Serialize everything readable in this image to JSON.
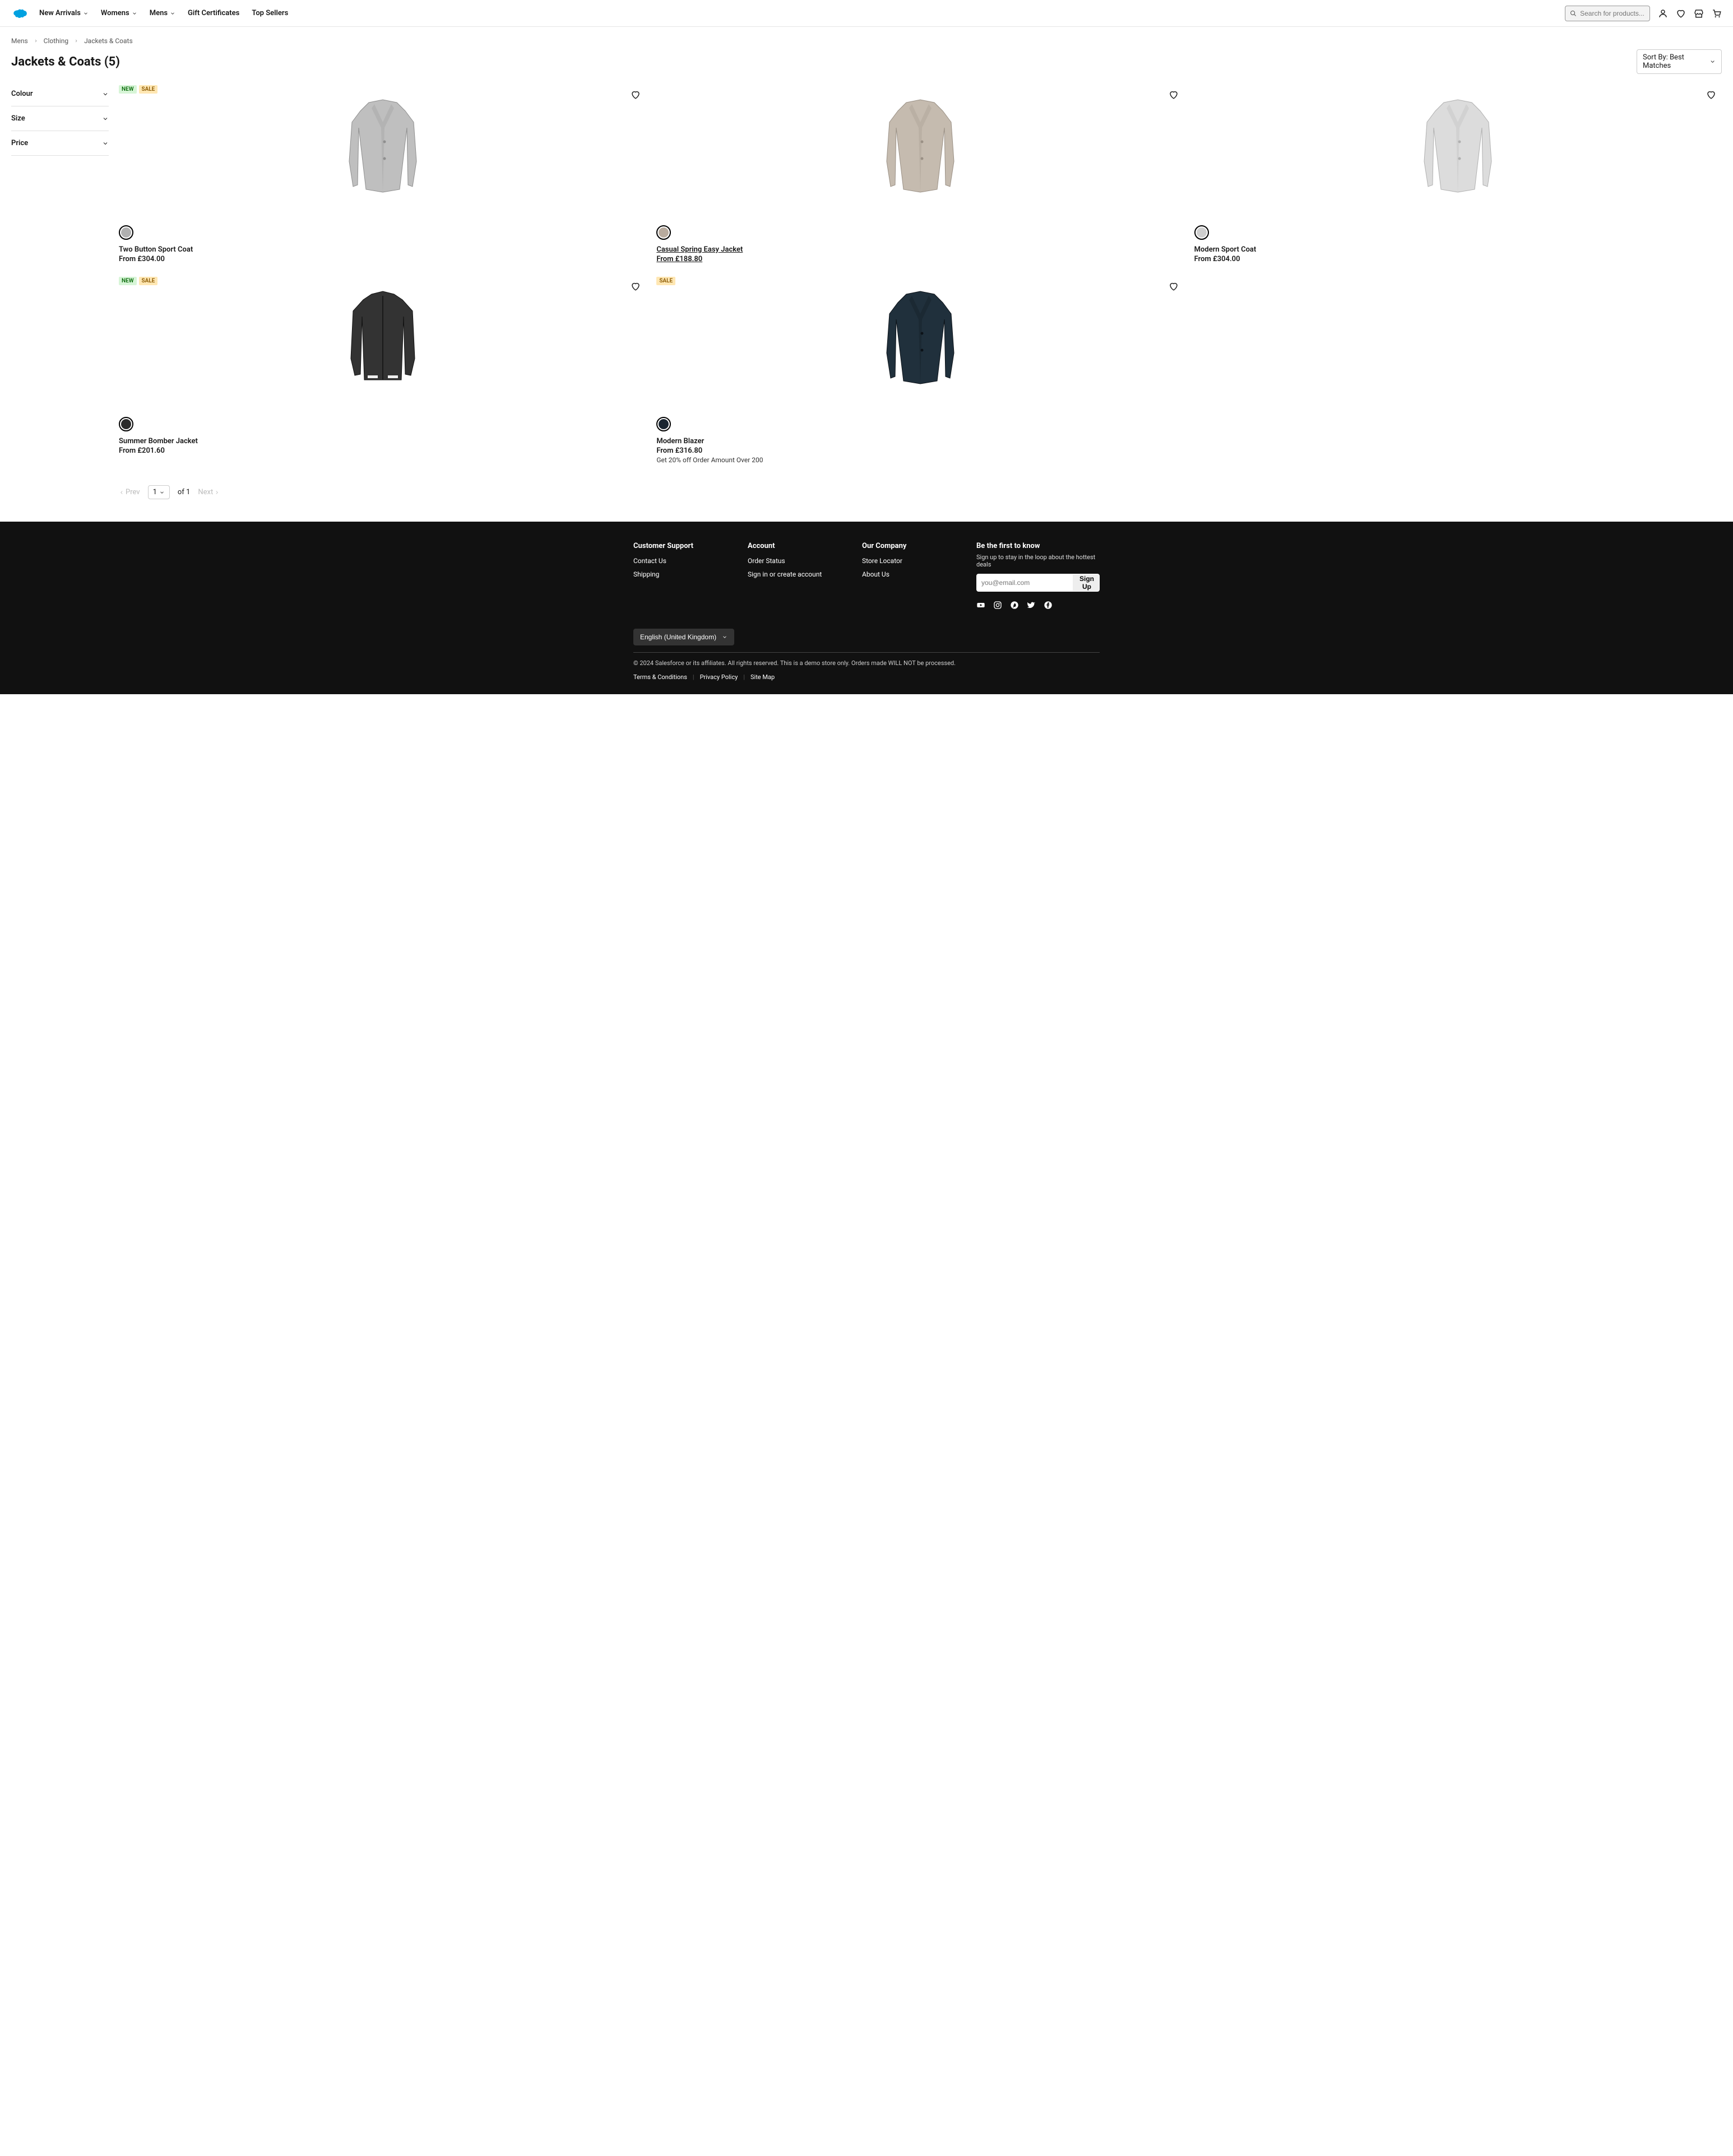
{
  "header": {
    "nav": [
      "New Arrivals",
      "Womens",
      "Mens",
      "Gift Certificates",
      "Top Sellers"
    ],
    "nav_has_dropdown": [
      true,
      true,
      true,
      false,
      false
    ],
    "search_placeholder": "Search for products...",
    "icons": [
      "account-icon",
      "wishlist-icon",
      "store-icon",
      "cart-icon"
    ]
  },
  "breadcrumb": [
    "Mens",
    "Clothing",
    "Jackets & Coats"
  ],
  "title": "Jackets & Coats (5)",
  "sort_label": "Sort By: Best Matches",
  "filters": [
    "Colour",
    "Size",
    "Price"
  ],
  "products": [
    {
      "name": "Two Button Sport Coat",
      "price": "From £304.00",
      "badges": [
        "NEW",
        "SALE"
      ],
      "swatch": "#b0b0b0",
      "jacket_fill": "#bfbfbf",
      "jacket_stroke": "#8e8e8e"
    },
    {
      "name": "Casual Spring Easy Jacket",
      "price": "From £188.80",
      "badges": [],
      "swatch": "#b8ab9e",
      "hover": true,
      "jacket_fill": "#c5bbaf",
      "jacket_stroke": "#9a9085"
    },
    {
      "name": "Modern Sport Coat",
      "price": "From £304.00",
      "badges": [],
      "swatch": "#cfcfcf",
      "jacket_fill": "#dcdcdc",
      "jacket_stroke": "#b0b0b0"
    },
    {
      "name": "Summer Bomber Jacket",
      "price": "From £201.60",
      "badges": [
        "NEW",
        "SALE"
      ],
      "swatch": "#2a2a2a",
      "jacket_fill": "#333333",
      "jacket_stroke": "#111",
      "bomber": true
    },
    {
      "name": "Modern Blazer",
      "price": "From £316.80",
      "promo": "Get 20% off Order Amount Over 200",
      "badges": [
        "SALE"
      ],
      "swatch": "#1a2530",
      "jacket_fill": "#20303c",
      "jacket_stroke": "#0c1218"
    }
  ],
  "pagination": {
    "prev": "Prev",
    "next": "Next",
    "current": "1",
    "of_label": "of 1"
  },
  "footer": {
    "cols": [
      {
        "title": "Customer Support",
        "links": [
          "Contact Us",
          "Shipping"
        ]
      },
      {
        "title": "Account",
        "links": [
          "Order Status",
          "Sign in or create account"
        ]
      },
      {
        "title": "Our Company",
        "links": [
          "Store Locator",
          "About Us"
        ]
      }
    ],
    "newsletter": {
      "title": "Be the first to know",
      "desc": "Sign up to stay in the loop about the hottest deals",
      "placeholder": "you@email.com",
      "button": "Sign Up"
    },
    "socials": [
      "youtube-icon",
      "instagram-icon",
      "pinterest-icon",
      "twitter-icon",
      "facebook-icon"
    ],
    "locale": "English (United Kingdom)",
    "copyright": "© 2024 Salesforce or its affiliates. All rights reserved. This is a demo store only. Orders made WILL NOT be processed.",
    "legal": [
      "Terms & Conditions",
      "Privacy Policy",
      "Site Map"
    ]
  }
}
